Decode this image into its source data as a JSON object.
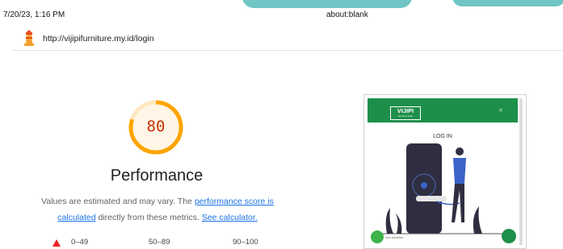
{
  "print": {
    "date": "7/20/23, 1:16 PM",
    "title": "about:blank"
  },
  "report": {
    "url": "http://vijipifurniture.my.id/login"
  },
  "score": {
    "value": "80",
    "fraction": 0.8,
    "label": "Performance",
    "color": "#ffa400"
  },
  "description": {
    "text_1": "Values are estimated and may vary. The ",
    "link_1": "performance score is calculated",
    "text_2": " directly from these metrics. ",
    "link_2": "See calculator."
  },
  "legend": {
    "fail": "0–49",
    "average": "50–89",
    "pass": "90–100"
  },
  "screenshot": {
    "logo": "VIJIPI",
    "logo_sub": "furniture shop",
    "close": "×",
    "page_title": "LOG IN",
    "whatsapp_text": "Info Address"
  },
  "icons": [
    "lighthouse-icon",
    "whatsapp-icon",
    "chat-icon"
  ]
}
